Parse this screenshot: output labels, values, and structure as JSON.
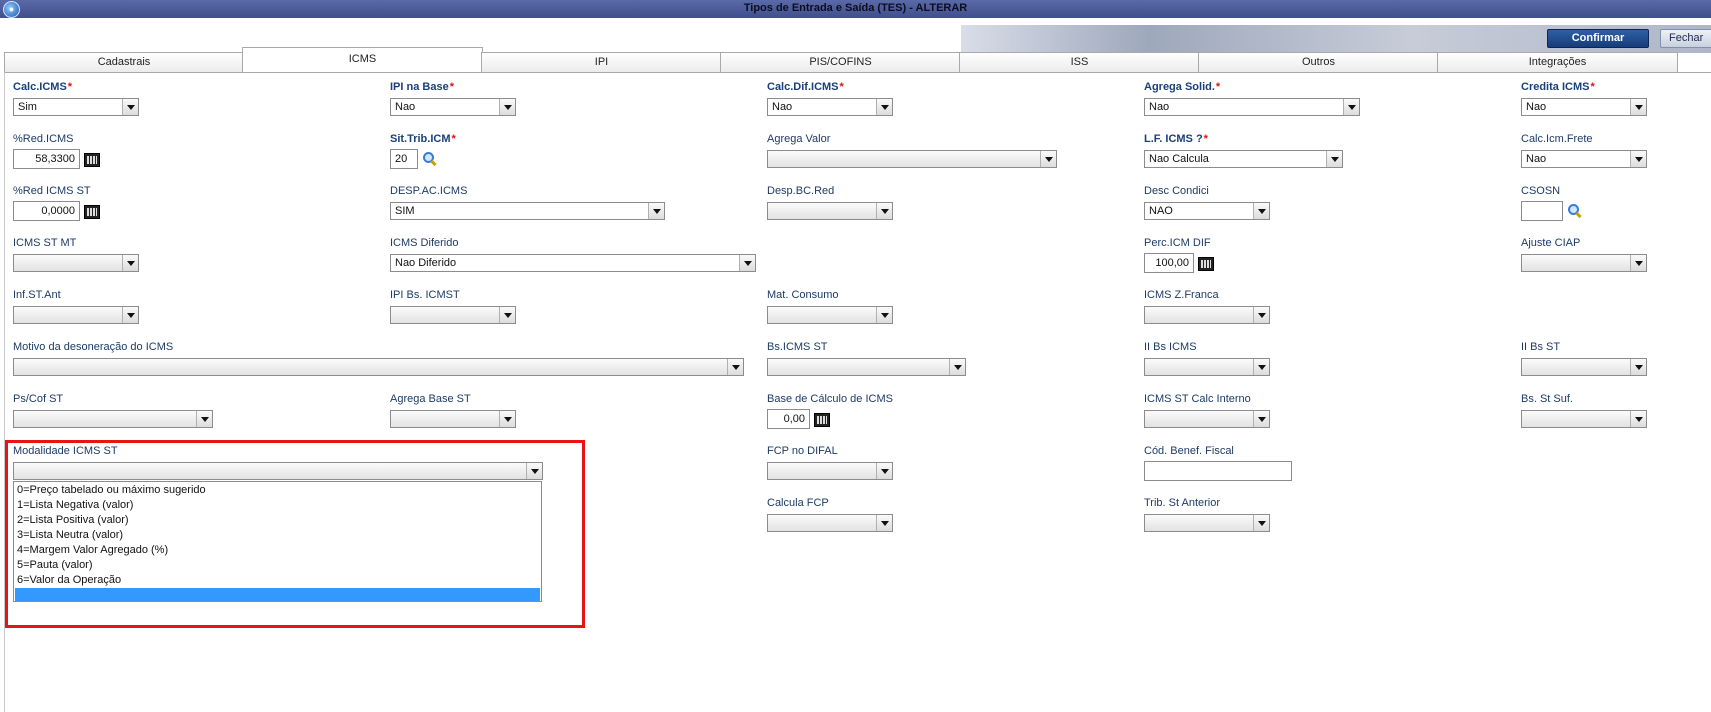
{
  "window": {
    "title": "Tipos de Entrada e Saída (TES) - ALTERAR"
  },
  "toolbar": {
    "confirm_label": "Confirmar",
    "close_label": "Fechar"
  },
  "tabs": [
    "Cadastrais",
    "ICMS",
    "IPI",
    "PIS/COFINS",
    "ISS",
    "Outros",
    "Integrações"
  ],
  "fields": {
    "calc_icms": {
      "label": "Calc.ICMS",
      "value": "Sim"
    },
    "ipi_na_base": {
      "label": "IPI na Base",
      "value": "Nao"
    },
    "calc_dif_icms": {
      "label": "Calc.Dif.ICMS",
      "value": "Nao"
    },
    "agrega_solid": {
      "label": "Agrega Solid.",
      "value": "Nao"
    },
    "credita_icms": {
      "label": "Credita ICMS",
      "value": "Nao"
    },
    "red_icms": {
      "label": "%Red.ICMS",
      "value": "58,3300"
    },
    "sit_trib_icm": {
      "label": "Sit.Trib.ICM",
      "value": "20"
    },
    "agrega_valor": {
      "label": "Agrega Valor",
      "value": ""
    },
    "lf_icms": {
      "label": "L.F. ICMS ?",
      "value": "Nao Calcula"
    },
    "calc_icm_frete": {
      "label": "Calc.Icm.Frete",
      "value": "Nao"
    },
    "red_icms_st": {
      "label": "%Red ICMS ST",
      "value": "0,0000"
    },
    "desp_ac_icms": {
      "label": "DESP.AC.ICMS",
      "value": "SIM"
    },
    "desp_bc_red": {
      "label": "Desp.BC.Red",
      "value": ""
    },
    "desc_condici": {
      "label": "Desc Condici",
      "value": "NAO"
    },
    "csosn": {
      "label": "CSOSN",
      "value": ""
    },
    "icms_st_mt": {
      "label": "ICMS ST MT",
      "value": ""
    },
    "icms_diferido": {
      "label": "ICMS Diferido",
      "value": "Nao Diferido"
    },
    "perc_icm_dif": {
      "label": "Perc.ICM DIF",
      "value": "100,00"
    },
    "ajuste_ciap": {
      "label": "Ajuste CIAP",
      "value": ""
    },
    "inf_st_ant": {
      "label": "Inf.ST.Ant",
      "value": ""
    },
    "ipi_bs_icmst": {
      "label": "IPI Bs. ICMST",
      "value": ""
    },
    "mat_consumo": {
      "label": "Mat. Consumo",
      "value": ""
    },
    "icms_z_franca": {
      "label": "ICMS Z.Franca",
      "value": ""
    },
    "motivo_desoneracao": {
      "label": "Motivo da desoneração do ICMS",
      "value": ""
    },
    "bs_icms_st": {
      "label": "Bs.ICMS ST",
      "value": ""
    },
    "ii_bs_icms": {
      "label": "II Bs ICMS",
      "value": ""
    },
    "ii_bs_st": {
      "label": "II Bs ST",
      "value": ""
    },
    "ps_cof_st": {
      "label": "Ps/Cof ST",
      "value": ""
    },
    "agrega_base_st": {
      "label": "Agrega Base ST",
      "value": ""
    },
    "base_calc_icms": {
      "label": "Base de Cálculo de ICMS",
      "value": "0,00"
    },
    "icms_st_calc_interno": {
      "label": "ICMS ST Calc Interno",
      "value": ""
    },
    "bs_st_suf": {
      "label": "Bs. St Suf.",
      "value": ""
    },
    "modalidade_icms_st": {
      "label": "Modalidade ICMS ST",
      "value": ""
    },
    "fcp_no_difal": {
      "label": "FCP no DIFAL",
      "value": ""
    },
    "cod_benef_fiscal": {
      "label": "Cód. Benef. Fiscal",
      "value": ""
    },
    "calcula_fcp": {
      "label": "Calcula FCP",
      "value": ""
    },
    "trib_st_anterior": {
      "label": "Trib. St Anterior",
      "value": ""
    }
  },
  "modalidade_options": [
    "0=Preço tabelado ou máximo sugerido",
    "1=Lista Negativa (valor)",
    "2=Lista Positiva (valor)",
    "3=Lista Neutra (valor)",
    "4=Margem Valor Agregado (%)",
    "5=Pauta (valor)",
    "6=Valor da Operação",
    ""
  ],
  "modalidade_selected_index": 7,
  "colors": {
    "highlight": "#e81414",
    "selection": "#3399ff",
    "confirm": "#1f4a8c"
  }
}
